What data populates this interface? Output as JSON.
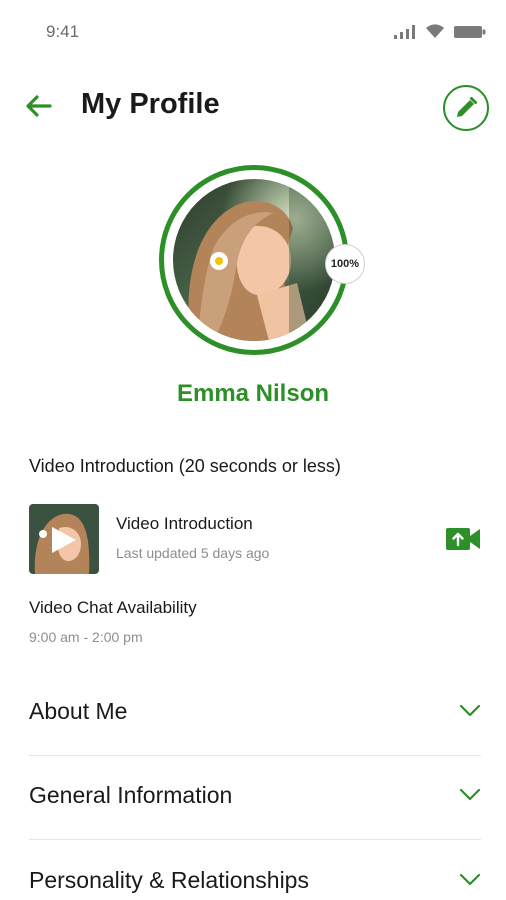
{
  "status_bar": {
    "time": "9:41"
  },
  "header": {
    "title": "My Profile"
  },
  "profile": {
    "name": "Emma Nilson",
    "completion": "100%"
  },
  "video_intro": {
    "section_label": "Video Introduction (20 seconds or less)",
    "title": "Video Introduction",
    "subtitle": "Last updated 5 days ago"
  },
  "availability": {
    "label": "Video Chat Availability",
    "time": "9:00 am - 2:00 pm"
  },
  "sections": [
    {
      "label": "About Me"
    },
    {
      "label": "General Information"
    },
    {
      "label": "Personality & Relationships"
    }
  ],
  "colors": {
    "accent": "#2c8f27",
    "text": "#1a1a1a",
    "muted": "#8d8d8d",
    "divider": "#e6e6e6"
  },
  "icons": {
    "back": "arrow-left-icon",
    "edit": "pencil-icon",
    "video_upload": "video-camera-upload-icon",
    "chevron": "chevron-down-icon",
    "play": "play-icon"
  }
}
